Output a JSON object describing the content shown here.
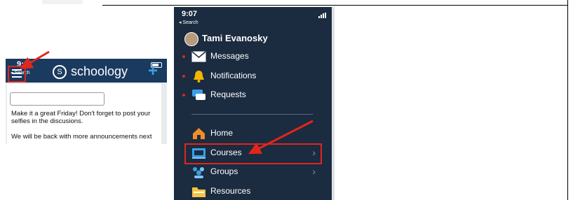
{
  "left_phone": {
    "time": "9:07",
    "back_label": "◂ Search",
    "brand": "schoology",
    "brand_mark": "S",
    "add_symbol": "+",
    "message_line1": "Make it a great Friday!  Don't forget to post your selfies in the discusions.",
    "message_line2": "We will be back with more announcements next"
  },
  "right_phone": {
    "time": "9:07",
    "back_label": "◂ Search",
    "user_name": "Tami Evanosky",
    "notif_items": [
      {
        "label": "Messages",
        "icon": "envelope-icon"
      },
      {
        "label": "Notifications",
        "icon": "bell-icon"
      },
      {
        "label": "Requests",
        "icon": "chat-icon"
      }
    ],
    "nav_items": [
      {
        "label": "Home",
        "icon": "home-icon"
      },
      {
        "label": "Courses",
        "icon": "courses-icon"
      },
      {
        "label": "Groups",
        "icon": "groups-icon"
      },
      {
        "label": "Resources",
        "icon": "folder-icon"
      }
    ],
    "chevron": "›"
  },
  "colors": {
    "nav_bg": "#1a3a60",
    "drawer_bg": "#1b2b40",
    "highlight": "#e0261b",
    "accent": "#3a9fe6"
  }
}
